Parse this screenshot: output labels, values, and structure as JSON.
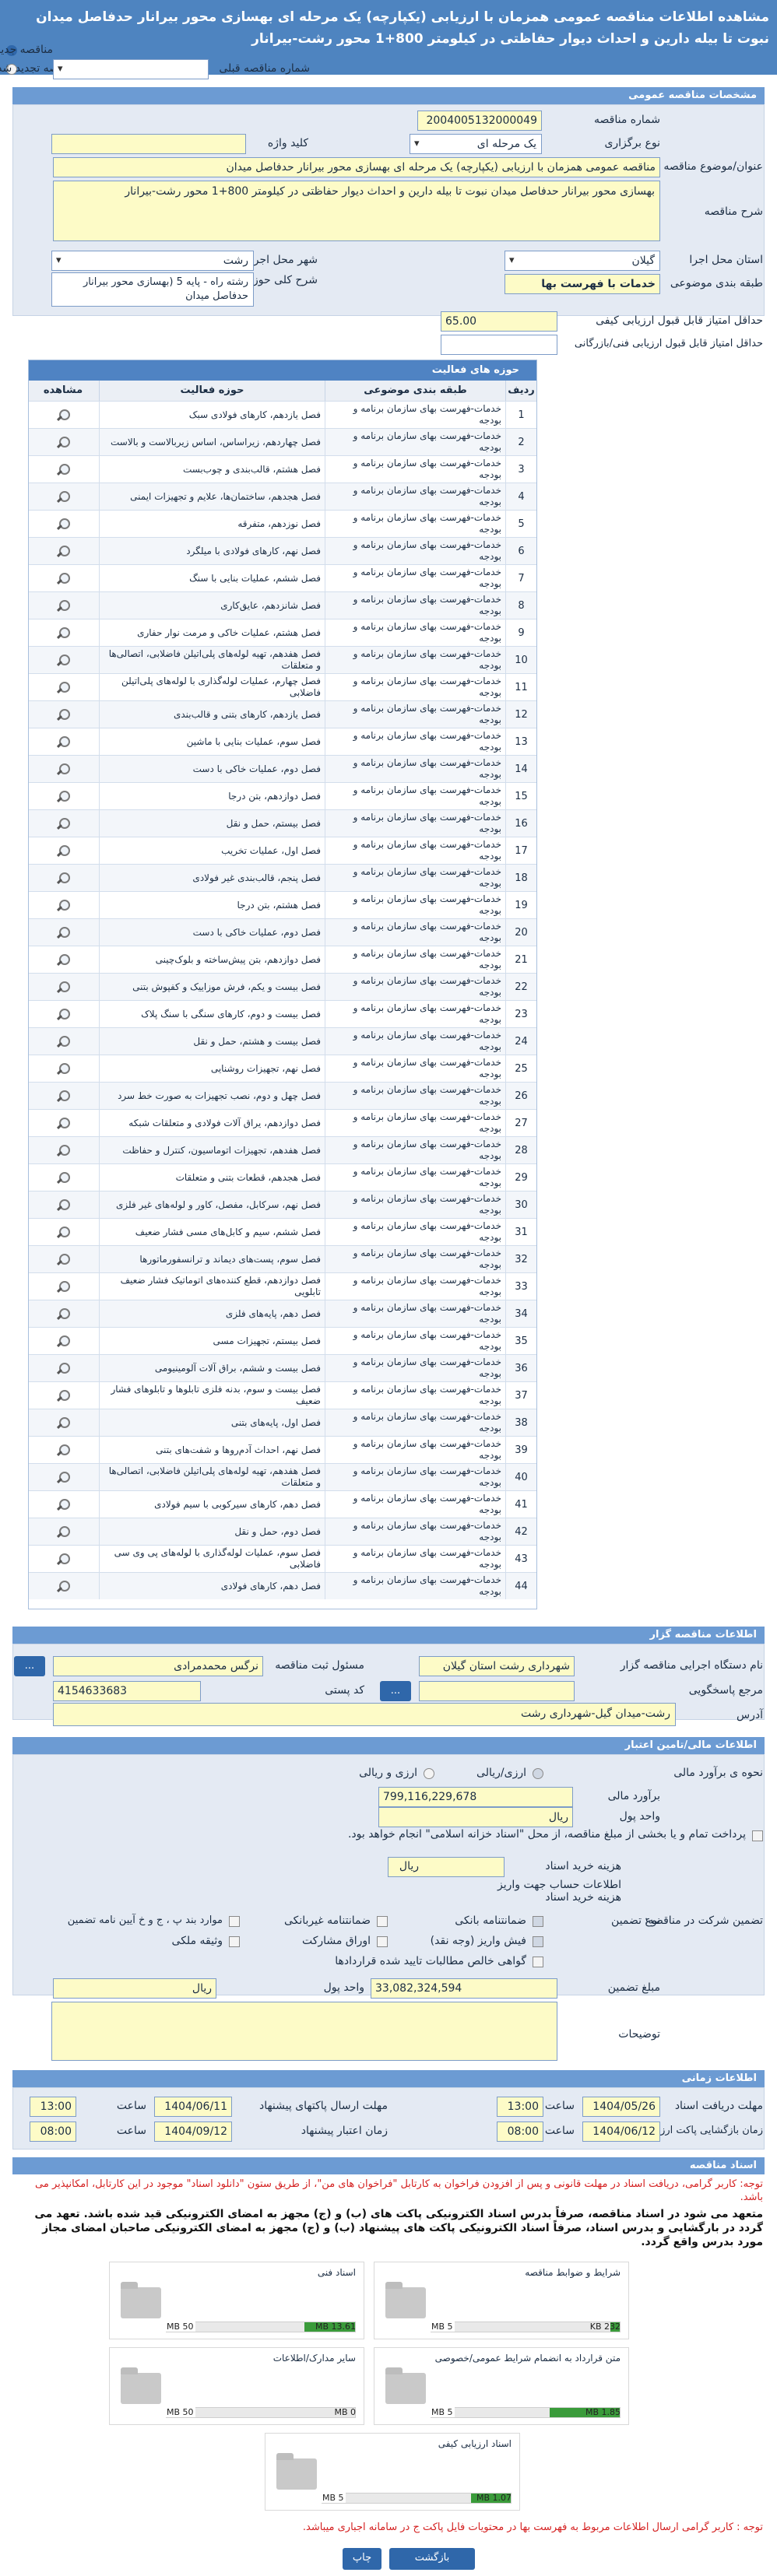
{
  "header": {
    "title": "مشاهده اطلاعات مناقصه عمومی همزمان با ارزیابی (یکپارچه) یک مرحله ای بهسازی محور بیرانار حدفاصل میدان نبوت تا بیله دارین و احداث دیوار حفاظتی در کیلومتر 800+1 محور رشت-بیرانار"
  },
  "top_opts": {
    "new": "مناقصه جدید",
    "renewed": "مناقصه تجدید شده",
    "prev_no": "شماره مناقصه قبلی"
  },
  "sections": {
    "general": "مشخصات مناقصه عمومی",
    "scope": "حوزه فعالیت",
    "scope_grid": "حوزه های فعالیت",
    "organizer": "اطلاعات مناقصه گزار",
    "finance": "اطلاعات مالی/تامین اعتبار",
    "timing": "اطلاعات زمانی",
    "docs": "اسناد مناقصه"
  },
  "general": {
    "tender_no_label": "شماره مناقصه",
    "tender_no": "2004005132000049",
    "type_label": "نوع برگزاری",
    "type": "یک مرحله ای",
    "keyword_label": "کلید واژه",
    "keyword": "",
    "subject_label": "عنوان/موضوع مناقصه",
    "subject": "مناقصه عمومی همزمان با ارزیابی (یکپارچه) یک مرحله ای بهسازی محور بیرانار حدفاصل میدان",
    "desc_label": "شرح مناقصه",
    "desc": "بهسازی محور بیرانار حدفاصل میدان نبوت تا بیله دارین و احداث دیوار حفاظتی در کیلومتر 800+1 محور رشت-بیرانار",
    "province_label": "استان محل اجرا",
    "province": "گیلان",
    "city_label": "شهر محل اجرا",
    "city": "رشت",
    "category_label": "طبقه بندی موضوعی",
    "category": "خدمات با فهرست بها",
    "scope_desc_label": "شرح کلی حوزه فعالیت",
    "scope_desc": "رشته راه - پایه 5 (بهسازی محور بیرانار حدفاصل میدان",
    "min_tech_label": "حداقل امتیاز قابل قبول ارزیابی کیفی",
    "min_tech": "65.00",
    "min_fin_label": "حداقل امتیاز قابل قبول ارزیابی فنی/بازرگانی",
    "min_fin": ""
  },
  "grid": {
    "cols": [
      "ردیف",
      "طبقه بندی موضوعی",
      "حوزه فعالیت",
      "مشاهده"
    ],
    "rows": [
      {
        "n": "1",
        "cat": "خدمات-فهرست بهای سازمان برنامه و بودجه",
        "act": "فصل یازدهم، کارهای فولادی سبک"
      },
      {
        "n": "2",
        "cat": "خدمات-فهرست بهای سازمان برنامه و بودجه",
        "act": "فصل چهاردهم، زیراساس، اساس زیربالاست و بالاست"
      },
      {
        "n": "3",
        "cat": "خدمات-فهرست بهای سازمان برنامه و بودجه",
        "act": "فصل هشتم، قالب‌بندی و چوب‌بست"
      },
      {
        "n": "4",
        "cat": "خدمات-فهرست بهای سازمان برنامه و بودجه",
        "act": "فصل هجدهم، ساختمان‌ها، علایم و تجهیزات ایمنی"
      },
      {
        "n": "5",
        "cat": "خدمات-فهرست بهای سازمان برنامه و بودجه",
        "act": "فصل نوزدهم، متفرقه"
      },
      {
        "n": "6",
        "cat": "خدمات-فهرست بهای سازمان برنامه و بودجه",
        "act": "فصل نهم، کارهای فولادی با میلگرد"
      },
      {
        "n": "7",
        "cat": "خدمات-فهرست بهای سازمان برنامه و بودجه",
        "act": "فصل ششم، عملیات بنایی با سنگ"
      },
      {
        "n": "8",
        "cat": "خدمات-فهرست بهای سازمان برنامه و بودجه",
        "act": "فصل شانزدهم، عایق‌کاری"
      },
      {
        "n": "9",
        "cat": "خدمات-فهرست بهای سازمان برنامه و بودجه",
        "act": "فصل هشتم، عملیات خاکی و مرمت نوار حفاری"
      },
      {
        "n": "10",
        "cat": "خدمات-فهرست بهای سازمان برنامه و بودجه",
        "act": "فصل هفدهم، تهیه لوله‌های پلی‌اتیلن فاضلابی، اتصالی‌ها و متعلقات"
      },
      {
        "n": "11",
        "cat": "خدمات-فهرست بهای سازمان برنامه و بودجه",
        "act": "فصل چهارم، عملیات لوله‌گذاری با لوله‌های پلی‌اتیلن فاضلابی"
      },
      {
        "n": "12",
        "cat": "خدمات-فهرست بهای سازمان برنامه و بودجه",
        "act": "فصل یازدهم، کارهای بتنی و قالب‌بندی"
      },
      {
        "n": "13",
        "cat": "خدمات-فهرست بهای سازمان برنامه و بودجه",
        "act": "فصل سوم، عملیات بنایی با ماشین"
      },
      {
        "n": "14",
        "cat": "خدمات-فهرست بهای سازمان برنامه و بودجه",
        "act": "فصل دوم، عملیات خاکی با دست"
      },
      {
        "n": "15",
        "cat": "خدمات-فهرست بهای سازمان برنامه و بودجه",
        "act": "فصل دوازدهم، بتن درجا"
      },
      {
        "n": "16",
        "cat": "خدمات-فهرست بهای سازمان برنامه و بودجه",
        "act": "فصل بیستم، حمل و نقل"
      },
      {
        "n": "17",
        "cat": "خدمات-فهرست بهای سازمان برنامه و بودجه",
        "act": "فصل اول، عملیات تخریب"
      },
      {
        "n": "18",
        "cat": "خدمات-فهرست بهای سازمان برنامه و بودجه",
        "act": "فصل پنجم، قالب‌بندی غیر فولادی"
      },
      {
        "n": "19",
        "cat": "خدمات-فهرست بهای سازمان برنامه و بودجه",
        "act": "فصل هشتم، بتن درجا"
      },
      {
        "n": "20",
        "cat": "خدمات-فهرست بهای سازمان برنامه و بودجه",
        "act": "فصل دوم، عملیات خاکی با دست"
      },
      {
        "n": "21",
        "cat": "خدمات-فهرست بهای سازمان برنامه و بودجه",
        "act": "فصل دوازدهم، بتن پیش‌ساخته و بلوک‌چینی"
      },
      {
        "n": "22",
        "cat": "خدمات-فهرست بهای سازمان برنامه و بودجه",
        "act": "فصل بیست و یکم، فرش موزاییک و کفپوش بتنی"
      },
      {
        "n": "23",
        "cat": "خدمات-فهرست بهای سازمان برنامه و بودجه",
        "act": "فصل بیست و دوم، کارهای سنگی با سنگ پلاک"
      },
      {
        "n": "24",
        "cat": "خدمات-فهرست بهای سازمان برنامه و بودجه",
        "act": "فصل بیست و هشتم، حمل و نقل"
      },
      {
        "n": "25",
        "cat": "خدمات-فهرست بهای سازمان برنامه و بودجه",
        "act": "فصل نهم، تجهیزات روشنایی"
      },
      {
        "n": "26",
        "cat": "خدمات-فهرست بهای سازمان برنامه و بودجه",
        "act": "فصل چهل و دوم، نصب تجهیزات به صورت خط سرد"
      },
      {
        "n": "27",
        "cat": "خدمات-فهرست بهای سازمان برنامه و بودجه",
        "act": "فصل دوازدهم، یراق آلات فولادی و متعلقات شبکه"
      },
      {
        "n": "28",
        "cat": "خدمات-فهرست بهای سازمان برنامه و بودجه",
        "act": "فصل هفدهم، تجهیزات اتوماسیون، کنترل و حفاظت"
      },
      {
        "n": "29",
        "cat": "خدمات-فهرست بهای سازمان برنامه و بودجه",
        "act": "فصل هجدهم، قطعات بتنی و متعلقات"
      },
      {
        "n": "30",
        "cat": "خدمات-فهرست بهای سازمان برنامه و بودجه",
        "act": "فصل نهم، سرکابل، مفصل، کاور و لوله‌های غیر فلزی"
      },
      {
        "n": "31",
        "cat": "خدمات-فهرست بهای سازمان برنامه و بودجه",
        "act": "فصل ششم، سیم و کابل‌های مسی فشار ضعیف"
      },
      {
        "n": "32",
        "cat": "خدمات-فهرست بهای سازمان برنامه و بودجه",
        "act": "فصل سوم، پست‌های دیماند و ترانسفورماتورها"
      },
      {
        "n": "33",
        "cat": "خدمات-فهرست بهای سازمان برنامه و بودجه",
        "act": "فصل دوازدهم، قطع کننده‌های اتوماتیک فشار ضعیف تابلویی"
      },
      {
        "n": "34",
        "cat": "خدمات-فهرست بهای سازمان برنامه و بودجه",
        "act": "فصل دهم، پایه‌های فلزی"
      },
      {
        "n": "35",
        "cat": "خدمات-فهرست بهای سازمان برنامه و بودجه",
        "act": "فصل بیستم، تجهیزات مسی"
      },
      {
        "n": "36",
        "cat": "خدمات-فهرست بهای سازمان برنامه و بودجه",
        "act": "فصل بیست و ششم، براق آلات آلومینیومی"
      },
      {
        "n": "37",
        "cat": "خدمات-فهرست بهای سازمان برنامه و بودجه",
        "act": "فصل بیست و سوم، بدنه فلزی تابلوها و تابلوهای فشار ضعیف"
      },
      {
        "n": "38",
        "cat": "خدمات-فهرست بهای سازمان برنامه و بودجه",
        "act": "فصل اول، پایه‌های بتنی"
      },
      {
        "n": "39",
        "cat": "خدمات-فهرست بهای سازمان برنامه و بودجه",
        "act": "فصل نهم، احداث آدم‌روها و شفت‌های بتنی"
      },
      {
        "n": "40",
        "cat": "خدمات-فهرست بهای سازمان برنامه و بودجه",
        "act": "فصل هفدهم، تهیه لوله‌های پلی‌اتیلن فاضلابی، اتصالی‌ها و متعلقات"
      },
      {
        "n": "41",
        "cat": "خدمات-فهرست بهای سازمان برنامه و بودجه",
        "act": "فصل دهم، کارهای سیرکوبی با سیم فولادی"
      },
      {
        "n": "42",
        "cat": "خدمات-فهرست بهای سازمان برنامه و بودجه",
        "act": "فصل دوم، حمل و نقل"
      },
      {
        "n": "43",
        "cat": "خدمات-فهرست بهای سازمان برنامه و بودجه",
        "act": "فصل سوم، عملیات لوله‌گذاری با لوله‌های پی وی سی فاضلابی"
      },
      {
        "n": "44",
        "cat": "خدمات-فهرست بهای سازمان برنامه و بودجه",
        "act": "فصل دهم، کارهای فولادی"
      }
    ]
  },
  "organizer": {
    "org_label": "نام دستگاه اجرایی مناقصه گزار",
    "org": "شهرداری رشت استان گیلان",
    "resp_label": "مسئول ثبت مناقصه",
    "resp": "نرگس محمدمرادی",
    "ref_label": "مرجع پاسخگویی",
    "ref": "",
    "postal_label": "کد پستی",
    "postal": "4154633683",
    "addr_label": "آدرس",
    "addr": "رشت-میدان گیل-شهرداری رشت",
    "more_btn": "..."
  },
  "finance": {
    "estimate_type_label": "نحوه ی برآورد مالی",
    "opt_rial": "ارزی/ریالی",
    "opt_mix": "ارزی و ریالی",
    "estimate_label": "برآورد مالی",
    "estimate": "799,116,229,678",
    "unit_label": "واحد پول",
    "unit": "ریال",
    "payment_label": "پرداخت تمام و یا بخشی از مبلغ مناقصه، از محل \"اسناد خزانه اسلامی\" انجام خواهد بود.",
    "fee_label": "هزینه خرید اسناد",
    "fee": "",
    "fee_unit": "ریال",
    "account_label": "اطلاعات حساب جهت واریز هزینه خرید اسناد",
    "guarantee_label": "تضمین شرکت در مناقصه:",
    "g_type_label": "نوع تضمین",
    "g_opts": [
      "ضمانتنامه بانکی",
      "ضمانتنامه غیربانکی",
      "موارد بند پ ، ج و خ آیین نامه تضمین",
      "فیش واریز (وجه نقد)",
      "اوراق مشارکت",
      "وثیقه ملکی",
      "گواهی خالص مطالبات تایید شده قراردادها"
    ],
    "amount_label": "مبلغ تضمین",
    "amount": "33,082,324,594",
    "amount_unit_label": "واحد پول",
    "amount_unit": "ریال",
    "notes_label": "توضیحات",
    "notes": ""
  },
  "timing": {
    "recv_label": "مهلت دریافت اسناد",
    "recv_date": "1404/05/26",
    "recv_time": "13:00",
    "send_label": "مهلت ارسال پاکتهای پیشنهاد",
    "send_date": "1404/06/11",
    "send_time": "13:00",
    "open_label": "زمان بازگشایی پاکت ارزیابی کیفی",
    "open_date": "1404/06/12",
    "open_time": "08:00",
    "valid_label": "زمان اعتبار پیشنهاد",
    "valid_date": "1404/09/12",
    "valid_time": "08:00",
    "time_label": "ساعت"
  },
  "docs": {
    "note1": "توجه: کاربر گرامی، دریافت اسناد در مهلت قانونی و پس از افزودن فراخوان به کارتابل \"فراخوان های من\"، از طریق ستون \"دانلود اسناد\" موجود در این کارتابل، امکانپذیر می باشد.",
    "warn": "متعهد می شود در اسناد مناقصه، صرفاً بدرس اسناد الکترونیکی پاکت های (ب) و (ج) مجهز به امضای الکترونیکی قید شده باشد. تعهد می گردد در بارگشایی و بدرس اسناد، صرفاً اسناد الکترونیکی پاکت های پیشنهاد (ب) و (ج) مجهز به امضای الکترونیکی صاحبان امضای مجاز مورد بدرس واقع گردد.",
    "cards": [
      {
        "title": "شرایط و ضوابط مناقصه",
        "max": "5 MB",
        "cur": "232 KB",
        "pct": 0.05
      },
      {
        "title": "اسناد فنی",
        "max": "50 MB",
        "cur": "13.61 MB",
        "pct": 0.27
      },
      {
        "title": "متن قرارداد به انضمام شرایط عمومی/خصوصی",
        "max": "5 MB",
        "cur": "1.85 MB",
        "pct": 0.37
      },
      {
        "title": "سایر مدارک/اطلاعات",
        "max": "50 MB",
        "cur": "0 MB",
        "pct": 0
      },
      {
        "title": "اسناد ارزیابی کیفی",
        "max": "5 MB",
        "cur": "1.07 MB",
        "pct": 0.21
      }
    ],
    "note2": "توجه : کاربر گرامی ارسال اطلاعات مربوط به فهرست بها در محتویات فایل پاکت ج در سامانه اجباری میباشد."
  },
  "footer": {
    "print": "چاپ",
    "back": "بازگشت"
  },
  "colors": {
    "header": "#4e84c0",
    "section": "#6c9bd3",
    "button": "#2f67aa",
    "progress": "#3a9b3a",
    "warn": "#d42020"
  }
}
